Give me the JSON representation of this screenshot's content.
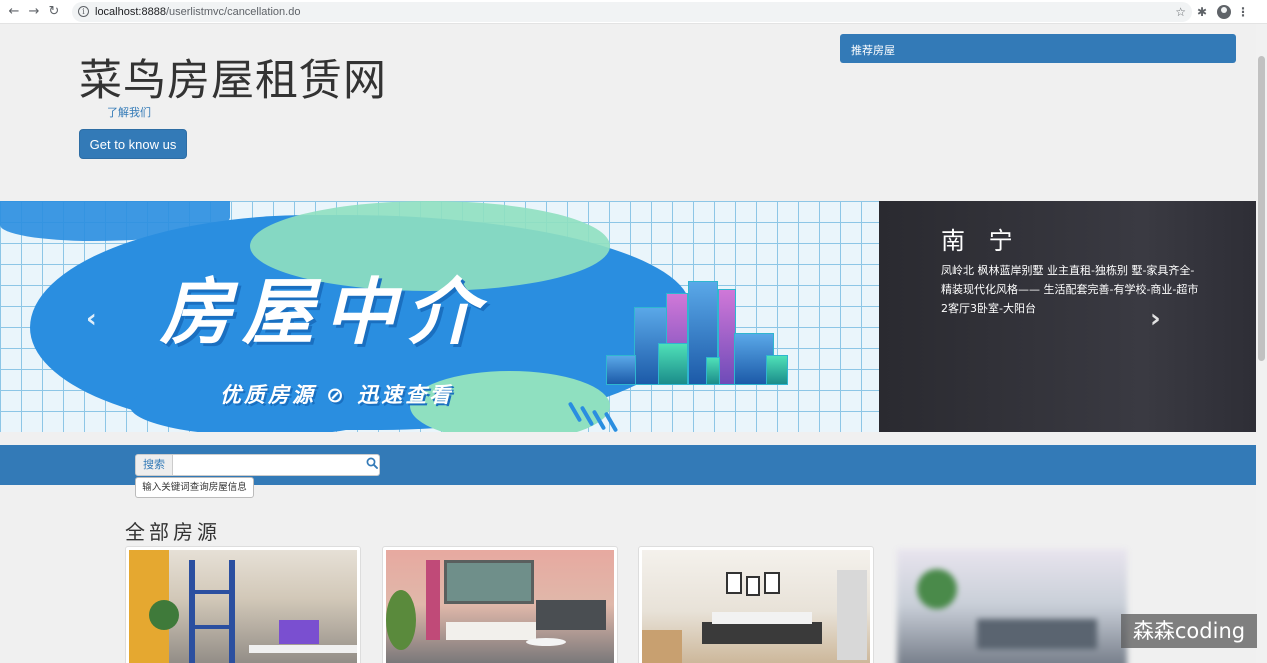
{
  "browser": {
    "url_host": "localhost:8888",
    "url_path": "/userlistmvc/cancellation.do"
  },
  "header": {
    "title": "菜鸟房屋租赁网",
    "about_link": "了解我们",
    "know_button": "Get to know us"
  },
  "sidebar": {
    "recommend_title": "推荐房屋"
  },
  "carousel": {
    "banner_title": "房屋中介",
    "banner_subtitle": "优质房源 ⊘ 迅速查看",
    "city": "南 宁",
    "description": "凤岭北 枫林蓝岸别墅 业主直租-独栋别 墅-家具齐全-精装现代化风格—— 生活配套完善-有学校-商业-超市 2客厅3卧室-大阳台",
    "prev_glyph": "‹",
    "next_glyph": "›"
  },
  "search": {
    "label": "搜索",
    "value": "",
    "tooltip": "输入关键词查询房屋信息"
  },
  "listings": {
    "title": "全部房源"
  },
  "watermark": "森森coding"
}
